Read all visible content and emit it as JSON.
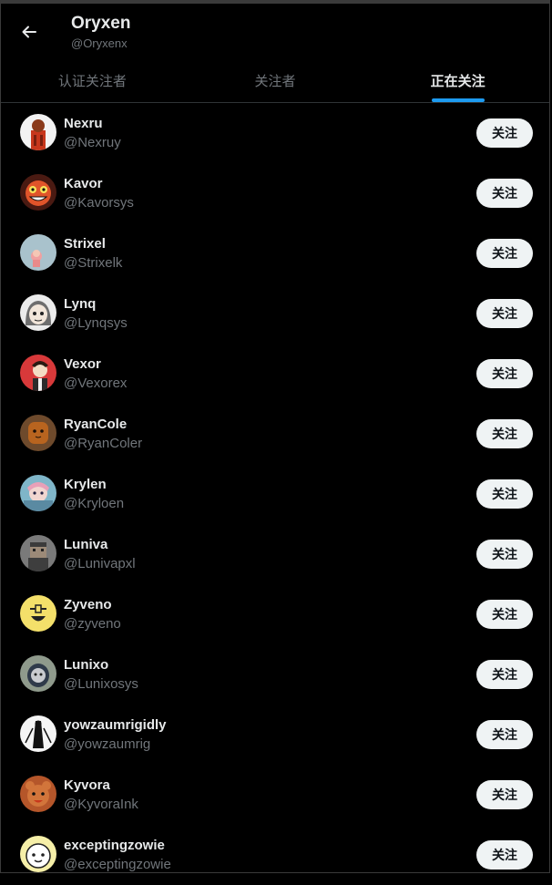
{
  "header": {
    "title": "Oryxen",
    "handle": "@Oryxenx",
    "back_icon": "arrow-left-icon"
  },
  "tabs": [
    {
      "label": "认证关注者",
      "active": false
    },
    {
      "label": "关注者",
      "active": false
    },
    {
      "label": "正在关注",
      "active": true
    }
  ],
  "accent": "#1d9bf0",
  "follow_label": "关注",
  "users": [
    {
      "name": "Nexru",
      "handle": "@Nexruy"
    },
    {
      "name": "Kavor",
      "handle": "@Kavorsys"
    },
    {
      "name": "Strixel",
      "handle": "@Strixelk"
    },
    {
      "name": "Lynq",
      "handle": "@Lynqsys"
    },
    {
      "name": "Vexor",
      "handle": "@Vexorex"
    },
    {
      "name": "RyanCole",
      "handle": "@RyanColer"
    },
    {
      "name": "Krylen",
      "handle": "@Kryloen"
    },
    {
      "name": "Luniva",
      "handle": "@Lunivapxl"
    },
    {
      "name": "Zyveno",
      "handle": "@zyveno"
    },
    {
      "name": "Lunixo",
      "handle": "@Lunixosys"
    },
    {
      "name": "yowzaumrigidly",
      "handle": "@yowzaumrig"
    },
    {
      "name": "Kyvora",
      "handle": "@KyvoraInk"
    },
    {
      "name": "exceptingzowie",
      "handle": "@exceptingzowie"
    }
  ]
}
